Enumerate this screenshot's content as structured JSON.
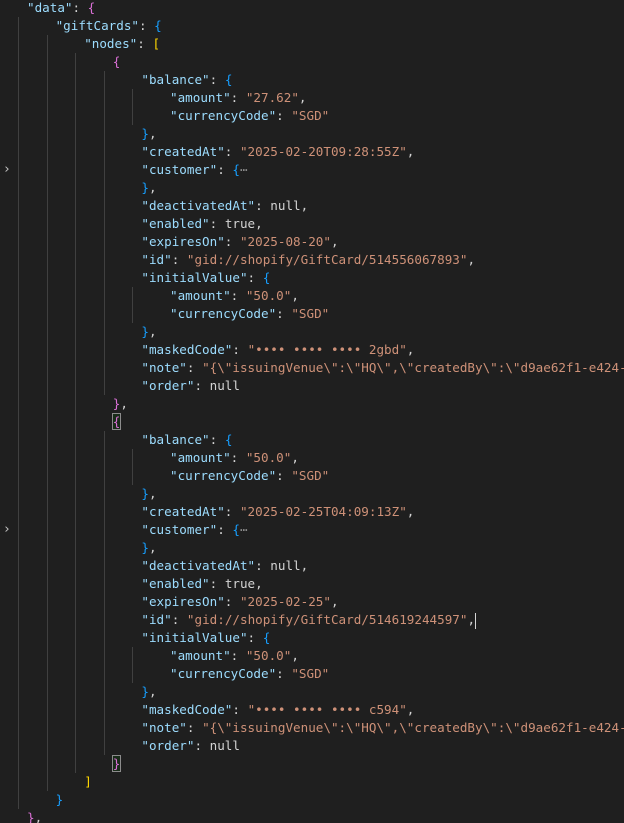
{
  "editor": {
    "fold_icon": "chevron-right-icon",
    "lines": [
      {
        "indent": 1,
        "tokens": [
          [
            "k",
            "\"data\""
          ],
          [
            "p",
            ": "
          ],
          [
            "b2",
            "{"
          ]
        ]
      },
      {
        "indent": 2,
        "tokens": [
          [
            "k",
            "\"giftCards\""
          ],
          [
            "p",
            ": "
          ],
          [
            "b3",
            "{"
          ]
        ]
      },
      {
        "indent": 3,
        "tokens": [
          [
            "k",
            "\"nodes\""
          ],
          [
            "p",
            ": "
          ],
          [
            "b1",
            "["
          ]
        ]
      },
      {
        "indent": 4,
        "tokens": [
          [
            "b2",
            "{"
          ]
        ]
      },
      {
        "indent": 5,
        "tokens": [
          [
            "k",
            "\"balance\""
          ],
          [
            "p",
            ": "
          ],
          [
            "b3",
            "{"
          ]
        ]
      },
      {
        "indent": 6,
        "tokens": [
          [
            "k",
            "\"amount\""
          ],
          [
            "p",
            ": "
          ],
          [
            "s",
            "\"27.62\""
          ],
          [
            "p",
            ","
          ]
        ]
      },
      {
        "indent": 6,
        "tokens": [
          [
            "k",
            "\"currencyCode\""
          ],
          [
            "p",
            ": "
          ],
          [
            "s",
            "\"SGD\""
          ]
        ]
      },
      {
        "indent": 5,
        "tokens": [
          [
            "b3",
            "}"
          ],
          [
            "p",
            ","
          ]
        ]
      },
      {
        "indent": 5,
        "tokens": [
          [
            "k",
            "\"createdAt\""
          ],
          [
            "p",
            ": "
          ],
          [
            "s",
            "\"2025-02-20T09:28:55Z\""
          ],
          [
            "p",
            ","
          ]
        ]
      },
      {
        "indent": 5,
        "fold": true,
        "tokens": [
          [
            "k",
            "\"customer\""
          ],
          [
            "p",
            ": "
          ],
          [
            "b3",
            "{"
          ],
          [
            "c",
            "⋯"
          ]
        ]
      },
      {
        "indent": 5,
        "tokens": [
          [
            "b3",
            "}"
          ],
          [
            "p",
            ","
          ]
        ]
      },
      {
        "indent": 5,
        "tokens": [
          [
            "k",
            "\"deactivatedAt\""
          ],
          [
            "p",
            ": "
          ],
          [
            "v",
            "null"
          ],
          [
            "p",
            ","
          ]
        ]
      },
      {
        "indent": 5,
        "tokens": [
          [
            "k",
            "\"enabled\""
          ],
          [
            "p",
            ": "
          ],
          [
            "v",
            "true"
          ],
          [
            "p",
            ","
          ]
        ]
      },
      {
        "indent": 5,
        "tokens": [
          [
            "k",
            "\"expiresOn\""
          ],
          [
            "p",
            ": "
          ],
          [
            "s",
            "\"2025-08-20\""
          ],
          [
            "p",
            ","
          ]
        ]
      },
      {
        "indent": 5,
        "tokens": [
          [
            "k",
            "\"id\""
          ],
          [
            "p",
            ": "
          ],
          [
            "s",
            "\"gid://shopify/GiftCard/514556067893\""
          ],
          [
            "p",
            ","
          ]
        ]
      },
      {
        "indent": 5,
        "tokens": [
          [
            "k",
            "\"initialValue\""
          ],
          [
            "p",
            ": "
          ],
          [
            "b3",
            "{"
          ]
        ]
      },
      {
        "indent": 6,
        "tokens": [
          [
            "k",
            "\"amount\""
          ],
          [
            "p",
            ": "
          ],
          [
            "s",
            "\"50.0\""
          ],
          [
            "p",
            ","
          ]
        ]
      },
      {
        "indent": 6,
        "tokens": [
          [
            "k",
            "\"currencyCode\""
          ],
          [
            "p",
            ": "
          ],
          [
            "s",
            "\"SGD\""
          ]
        ]
      },
      {
        "indent": 5,
        "tokens": [
          [
            "b3",
            "}"
          ],
          [
            "p",
            ","
          ]
        ]
      },
      {
        "indent": 5,
        "tokens": [
          [
            "k",
            "\"maskedCode\""
          ],
          [
            "p",
            ": "
          ],
          [
            "s",
            "\"•••• •••• •••• 2gbd\""
          ],
          [
            "p",
            ","
          ]
        ]
      },
      {
        "indent": 5,
        "tokens": [
          [
            "k",
            "\"note\""
          ],
          [
            "p",
            ": "
          ],
          [
            "s",
            "\"{\\\"issuingVenue\\\":\\\"HQ\\\",\\\"createdBy\\\":\\\"d9ae62f1-e424-"
          ]
        ]
      },
      {
        "indent": 5,
        "tokens": [
          [
            "k",
            "\"order\""
          ],
          [
            "p",
            ": "
          ],
          [
            "v",
            "null"
          ]
        ]
      },
      {
        "indent": 4,
        "tokens": [
          [
            "b2",
            "}"
          ],
          [
            "p",
            ","
          ]
        ]
      },
      {
        "indent": 4,
        "tokens": [
          [
            "b2",
            "{",
            "match"
          ]
        ]
      },
      {
        "indent": 5,
        "tokens": [
          [
            "k",
            "\"balance\""
          ],
          [
            "p",
            ": "
          ],
          [
            "b3",
            "{"
          ]
        ]
      },
      {
        "indent": 6,
        "tokens": [
          [
            "k",
            "\"amount\""
          ],
          [
            "p",
            ": "
          ],
          [
            "s",
            "\"50.0\""
          ],
          [
            "p",
            ","
          ]
        ]
      },
      {
        "indent": 6,
        "tokens": [
          [
            "k",
            "\"currencyCode\""
          ],
          [
            "p",
            ": "
          ],
          [
            "s",
            "\"SGD\""
          ]
        ]
      },
      {
        "indent": 5,
        "tokens": [
          [
            "b3",
            "}"
          ],
          [
            "p",
            ","
          ]
        ]
      },
      {
        "indent": 5,
        "tokens": [
          [
            "k",
            "\"createdAt\""
          ],
          [
            "p",
            ": "
          ],
          [
            "s",
            "\"2025-02-25T04:09:13Z\""
          ],
          [
            "p",
            ","
          ]
        ]
      },
      {
        "indent": 5,
        "fold": true,
        "tokens": [
          [
            "k",
            "\"customer\""
          ],
          [
            "p",
            ": "
          ],
          [
            "b3",
            "{"
          ],
          [
            "c",
            "⋯"
          ]
        ]
      },
      {
        "indent": 5,
        "tokens": [
          [
            "b3",
            "}"
          ],
          [
            "p",
            ","
          ]
        ]
      },
      {
        "indent": 5,
        "tokens": [
          [
            "k",
            "\"deactivatedAt\""
          ],
          [
            "p",
            ": "
          ],
          [
            "v",
            "null"
          ],
          [
            "p",
            ","
          ]
        ]
      },
      {
        "indent": 5,
        "tokens": [
          [
            "k",
            "\"enabled\""
          ],
          [
            "p",
            ": "
          ],
          [
            "v",
            "true"
          ],
          [
            "p",
            ","
          ]
        ]
      },
      {
        "indent": 5,
        "tokens": [
          [
            "k",
            "\"expiresOn\""
          ],
          [
            "p",
            ": "
          ],
          [
            "s",
            "\"2025-02-25\""
          ],
          [
            "p",
            ","
          ]
        ]
      },
      {
        "indent": 5,
        "cursor": true,
        "tokens": [
          [
            "k",
            "\"id\""
          ],
          [
            "p",
            ": "
          ],
          [
            "s",
            "\"gid://shopify/GiftCard/514619244597\""
          ],
          [
            "p",
            ","
          ]
        ]
      },
      {
        "indent": 5,
        "tokens": [
          [
            "k",
            "\"initialValue\""
          ],
          [
            "p",
            ": "
          ],
          [
            "b3",
            "{"
          ]
        ]
      },
      {
        "indent": 6,
        "tokens": [
          [
            "k",
            "\"amount\""
          ],
          [
            "p",
            ": "
          ],
          [
            "s",
            "\"50.0\""
          ],
          [
            "p",
            ","
          ]
        ]
      },
      {
        "indent": 6,
        "tokens": [
          [
            "k",
            "\"currencyCode\""
          ],
          [
            "p",
            ": "
          ],
          [
            "s",
            "\"SGD\""
          ]
        ]
      },
      {
        "indent": 5,
        "tokens": [
          [
            "b3",
            "}"
          ],
          [
            "p",
            ","
          ]
        ]
      },
      {
        "indent": 5,
        "tokens": [
          [
            "k",
            "\"maskedCode\""
          ],
          [
            "p",
            ": "
          ],
          [
            "s",
            "\"•••• •••• •••• c594\""
          ],
          [
            "p",
            ","
          ]
        ]
      },
      {
        "indent": 5,
        "tokens": [
          [
            "k",
            "\"note\""
          ],
          [
            "p",
            ": "
          ],
          [
            "s",
            "\"{\\\"issuingVenue\\\":\\\"HQ\\\",\\\"createdBy\\\":\\\"d9ae62f1-e424-"
          ]
        ]
      },
      {
        "indent": 5,
        "tokens": [
          [
            "k",
            "\"order\""
          ],
          [
            "p",
            ": "
          ],
          [
            "v",
            "null"
          ]
        ]
      },
      {
        "indent": 4,
        "tokens": [
          [
            "b2",
            "}",
            "match"
          ]
        ]
      },
      {
        "indent": 3,
        "tokens": [
          [
            "b1",
            "]"
          ]
        ]
      },
      {
        "indent": 2,
        "tokens": [
          [
            "b3",
            "}"
          ]
        ]
      },
      {
        "indent": 1,
        "tokens": [
          [
            "b2",
            "}"
          ],
          [
            "p",
            ","
          ]
        ]
      }
    ]
  }
}
